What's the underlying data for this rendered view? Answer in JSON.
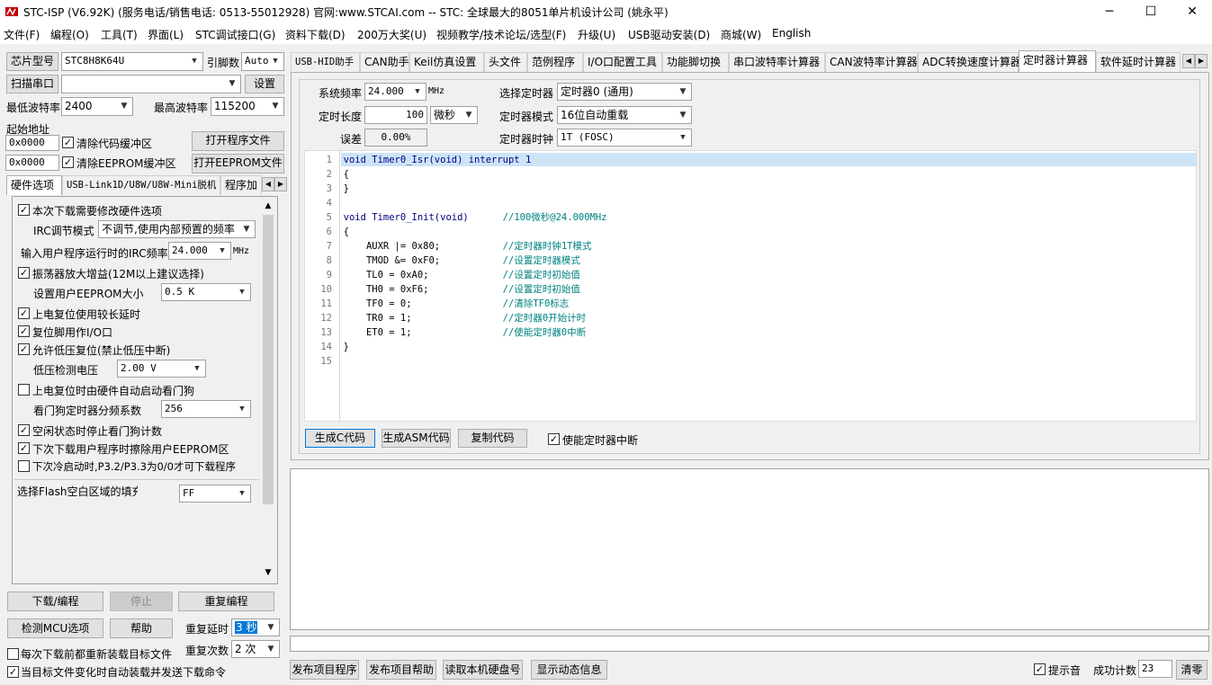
{
  "window": {
    "title": "STC-ISP (V6.92K) (服务电话/销售电话: 0513-55012928) 官网:www.STCAI.com  -- STC: 全球最大的8051单片机设计公司 (姚永平)",
    "icon": "stc-app-icon",
    "minimize": "─",
    "maximize": "☐",
    "close": "✕"
  },
  "menu": [
    "文件(F)",
    "编程(O)",
    "工具(T)",
    "界面(L)",
    "STC调试接口(G)",
    "资料下载(D)",
    "200万大奖(U)",
    "视频教学/技术论坛/选型(F)",
    "升级(U)",
    "USB驱动安装(D)",
    "商城(W)",
    "English"
  ],
  "left": {
    "chip_btn": "芯片型号",
    "chip_value": "STC8H8K64U",
    "pin_label": "引脚数",
    "pin_value": "Auto",
    "scan_btn": "扫描串口",
    "port_value": "",
    "settings_btn": "设置",
    "min_baud_label": "最低波特率",
    "min_baud_value": "2400",
    "max_baud_label": "最高波特率",
    "max_baud_value": "115200",
    "start_addr_label": "起始地址",
    "addr1": "0x0000",
    "clear_code_label": "清除代码缓冲区",
    "open_prog_btn": "打开程序文件",
    "addr2": "0x0000",
    "clear_eeprom_label": "清除EEPROM缓冲区",
    "open_eeprom_btn": "打开EEPROM文件",
    "tabs": [
      "硬件选项",
      "USB-Link1D/U8W/U8W-Mini脱机",
      "程序加"
    ],
    "hw": {
      "need_modify": "本次下载需要修改硬件选项",
      "irc_mode_label": "IRC调节模式",
      "irc_mode_value": "不调节,使用内部预置的频率",
      "irc_freq_label": "输入用户程序运行时的IRC频率",
      "irc_freq_value": "24.000",
      "irc_freq_unit": "MHz",
      "osc_gain": "振荡器放大增益(12M以上建议选择)",
      "eeprom_size_label": "设置用户EEPROM大小",
      "eeprom_size_value": "0.5 K",
      "power_on_delay": "上电复位使用较长延时",
      "reset_pin_io": "复位脚用作I/O口",
      "low_volt_reset": "允许低压复位(禁止低压中断)",
      "low_volt_label": "低压检测电压",
      "low_volt_value": "2.00 V",
      "wdt_auto": "上电复位时由硬件自动启动看门狗",
      "wdt_div_label": "看门狗定时器分频系数",
      "wdt_div_value": "256",
      "idle_stop_wdt": "空闲状态时停止看门狗计数",
      "erase_eeprom": "下次下载用户程序时擦除用户EEPROM区",
      "cold_boot": "下次冷启动时,P3.2/P3.3为0/0才可下载程序",
      "flash_fill_label": "选择Flash空白区域的填充",
      "flash_fill_value": "FF"
    },
    "download_btn": "下载/编程",
    "stop_btn": "停止",
    "reprogram_btn": "重复编程",
    "detect_btn": "检测MCU选项",
    "help_btn": "帮助",
    "repeat_delay_label": "重复延时",
    "repeat_delay_value": "3 秒",
    "repeat_count_label": "重复次数",
    "repeat_count_value": "2 次",
    "reload_label": "每次下载前都重新装载目标文件",
    "auto_send_label": "当目标文件变化时自动装载并发送下载命令"
  },
  "right": {
    "tabs": [
      "USB-HID助手",
      "CAN助手",
      "Keil仿真设置",
      "头文件",
      "范例程序",
      "I/O口配置工具",
      "功能脚切换",
      "串口波特率计算器",
      "CAN波特率计算器",
      "ADC转换速度计算器",
      "定时器计算器",
      "软件延时计算器"
    ],
    "timer": {
      "sys_freq_label": "系统频率",
      "sys_freq_value": "24.000",
      "sys_freq_unit": "MHz",
      "sel_timer_label": "选择定时器",
      "sel_timer_value": "定时器0 (通用)",
      "length_label": "定时长度",
      "length_value": "100",
      "length_unit": "微秒",
      "mode_label": "定时器模式",
      "mode_value": "16位自动重载",
      "error_label": "误差",
      "error_value": "0.00%",
      "clock_label": "定时器时钟",
      "clock_value": "1T  (FOSC)"
    },
    "code_lines": [
      {
        "n": "1",
        "code": "void Timer0_Isr(void) interrupt 1",
        "comment": ""
      },
      {
        "n": "2",
        "code": "{",
        "comment": ""
      },
      {
        "n": "3",
        "code": "}",
        "comment": ""
      },
      {
        "n": "4",
        "code": "",
        "comment": ""
      },
      {
        "n": "5",
        "code": "void Timer0_Init(void)      ",
        "comment": "//100微秒@24.000MHz"
      },
      {
        "n": "6",
        "code": "{",
        "comment": ""
      },
      {
        "n": "7",
        "code": "    AUXR |= 0x80;           ",
        "comment": "//定时器时钟1T模式"
      },
      {
        "n": "8",
        "code": "    TMOD &= 0xF0;           ",
        "comment": "//设置定时器模式"
      },
      {
        "n": "9",
        "code": "    TL0 = 0xA0;             ",
        "comment": "//设置定时初始值"
      },
      {
        "n": "10",
        "code": "    TH0 = 0xF6;             ",
        "comment": "//设置定时初始值"
      },
      {
        "n": "11",
        "code": "    TF0 = 0;                ",
        "comment": "//清除TF0标志"
      },
      {
        "n": "12",
        "code": "    TR0 = 1;                ",
        "comment": "//定时器0开始计时"
      },
      {
        "n": "13",
        "code": "    ET0 = 1;                ",
        "comment": "//使能定时器0中断"
      },
      {
        "n": "14",
        "code": "}",
        "comment": ""
      },
      {
        "n": "15",
        "code": "",
        "comment": ""
      }
    ],
    "gen_c_btn": "生成C代码",
    "gen_asm_btn": "生成ASM代码",
    "copy_btn": "复制代码",
    "enable_int_label": "使能定时器中断",
    "publish_btn": "发布项目程序",
    "publish_help_btn": "发布项目帮助",
    "read_disk_btn": "读取本机硬盘号",
    "show_dyn_btn": "显示动态信息",
    "beep_label": "提示音",
    "success_label": "成功计数",
    "success_value": "23",
    "clear_btn": "清零"
  }
}
